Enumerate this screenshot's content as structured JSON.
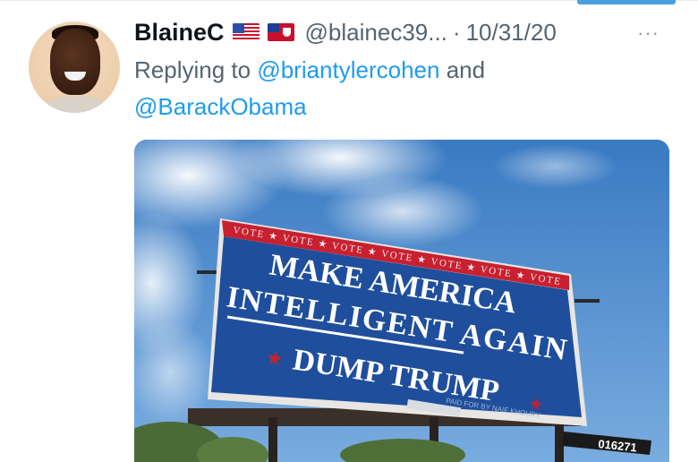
{
  "tweet": {
    "author_name": "BlaineC",
    "handle": "@blainec39...",
    "separator": "·",
    "date": "10/31/20",
    "more_label": "···",
    "flags": [
      "us-flag",
      "bermuda-flag"
    ],
    "replying_prefix": "Replying to",
    "mentions": [
      "@briantylercohen",
      "@BarackObama"
    ],
    "conjunction": "and"
  },
  "billboard": {
    "vote_band": "VOTE ★ VOTE ★ VOTE ★ VOTE ★ VOTE ★ VOTE ★ VOTE",
    "line1": "MAKE AMERICA",
    "line2": "INTELLIGENT AGAIN",
    "line3": "DUMP TRUMP",
    "star": "★",
    "paid_for": "PAID FOR BY NAIF KHOURY",
    "panel_number": "016271"
  },
  "colors": {
    "mention": "#1d9bf0",
    "muted": "#536471",
    "billboard_blue": "#1f4f9c",
    "billboard_red": "#c8202f"
  }
}
